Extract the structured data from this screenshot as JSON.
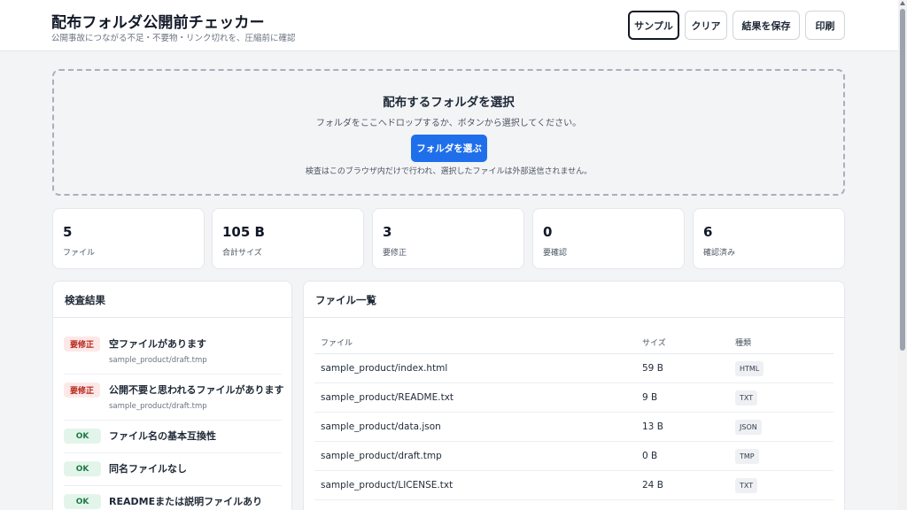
{
  "header": {
    "title": "配布フォルダ公開前チェッカー",
    "subtitle": "公開事故につながる不足・不要物・リンク切れを、圧縮前に確認",
    "buttons": {
      "sample": "サンプル",
      "clear": "クリア",
      "save": "結果を保存",
      "print": "印刷"
    }
  },
  "dropzone": {
    "title": "配布するフォルダを選択",
    "description": "フォルダをここへドロップするか、ボタンから選択してください。",
    "button": "フォルダを選ぶ",
    "note": "検査はこのブラウザ内だけで行われ、選択したファイルは外部送信されません。"
  },
  "stats": [
    {
      "value": "5",
      "label": "ファイル"
    },
    {
      "value": "105 B",
      "label": "合計サイズ"
    },
    {
      "value": "3",
      "label": "要修正"
    },
    {
      "value": "0",
      "label": "要確認"
    },
    {
      "value": "6",
      "label": "確認済み"
    }
  ],
  "results": {
    "title": "検査結果",
    "items": [
      {
        "badge": "要修正",
        "status": "ng",
        "title": "空ファイルがあります",
        "path": "sample_product/draft.tmp"
      },
      {
        "badge": "要修正",
        "status": "ng",
        "title": "公開不要と思われるファイルがあります",
        "path": "sample_product/draft.tmp"
      },
      {
        "badge": "OK",
        "status": "ok",
        "title": "ファイル名の基本互換性",
        "path": ""
      },
      {
        "badge": "OK",
        "status": "ok",
        "title": "同名ファイルなし",
        "path": ""
      },
      {
        "badge": "OK",
        "status": "ok",
        "title": "READMEまたは説明ファイルあり",
        "path": ""
      }
    ]
  },
  "files": {
    "title": "ファイル一覧",
    "columns": {
      "name": "ファイル",
      "size": "サイズ",
      "type": "種類"
    },
    "rows": [
      {
        "name": "sample_product/index.html",
        "size": "59 B",
        "type": "HTML"
      },
      {
        "name": "sample_product/README.txt",
        "size": "9 B",
        "type": "TXT"
      },
      {
        "name": "sample_product/data.json",
        "size": "13 B",
        "type": "JSON"
      },
      {
        "name": "sample_product/draft.tmp",
        "size": "0 B",
        "type": "TMP"
      },
      {
        "name": "sample_product/LICENSE.txt",
        "size": "24 B",
        "type": "TXT"
      }
    ]
  },
  "colors": {
    "primary": "#1f6feb",
    "ng_bg": "#fde8e8",
    "ng_text": "#b42318",
    "ok_bg": "#e3f5ea",
    "ok_text": "#1e7a46"
  }
}
